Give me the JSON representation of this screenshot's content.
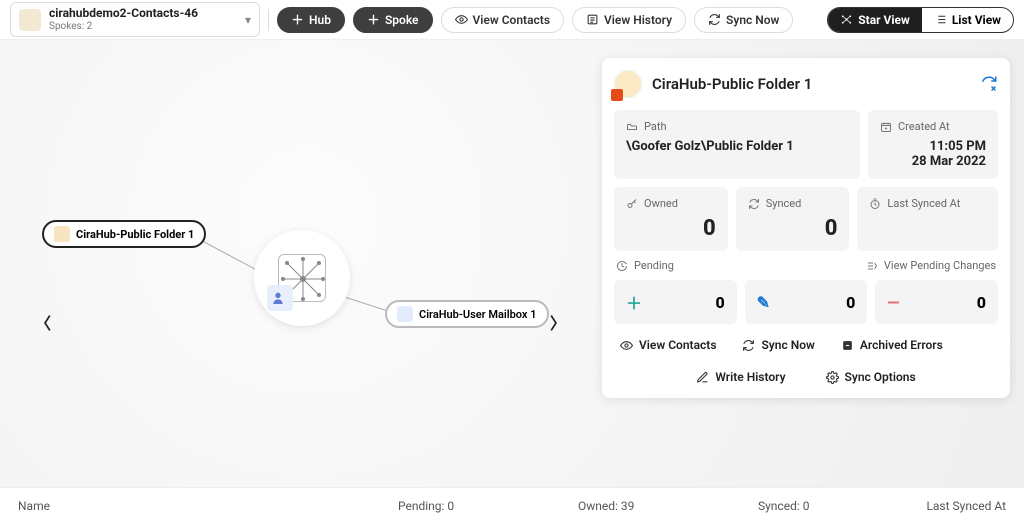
{
  "header": {
    "hub_name": "cirahubdemo2-Contacts-46",
    "hub_sub": "Spokes: 2",
    "btn_hub": "Hub",
    "btn_spoke": "Spoke",
    "btn_view_contacts": "View Contacts",
    "btn_view_history": "View History",
    "btn_sync_now": "Sync Now",
    "view_star": "Star View",
    "view_list": "List View"
  },
  "canvas": {
    "spoke_left": "CiraHub-Public Folder 1",
    "spoke_right": "CiraHub-User Mailbox 1"
  },
  "panel": {
    "title": "CiraHub-Public Folder 1",
    "path_label": "Path",
    "path_value": "\\Goofer Golz\\Public Folder 1",
    "created_label": "Created At",
    "created_time": "11:05 PM",
    "created_date": "28 Mar 2022",
    "owned_label": "Owned",
    "owned_value": "0",
    "synced_label": "Synced",
    "synced_value": "0",
    "last_synced_label": "Last Synced At",
    "pending_label": "Pending",
    "view_pending": "View Pending Changes",
    "pending_add": "0",
    "pending_edit": "0",
    "pending_del": "0",
    "act_view_contacts": "View Contacts",
    "act_sync_now": "Sync Now",
    "act_archived": "Archived Errors",
    "act_write_history": "Write History",
    "act_sync_options": "Sync Options"
  },
  "footer": {
    "col_name": "Name",
    "col_pending": "Pending: 0",
    "col_owned": "Owned: 39",
    "col_synced": "Synced: 0",
    "col_last": "Last Synced At"
  }
}
